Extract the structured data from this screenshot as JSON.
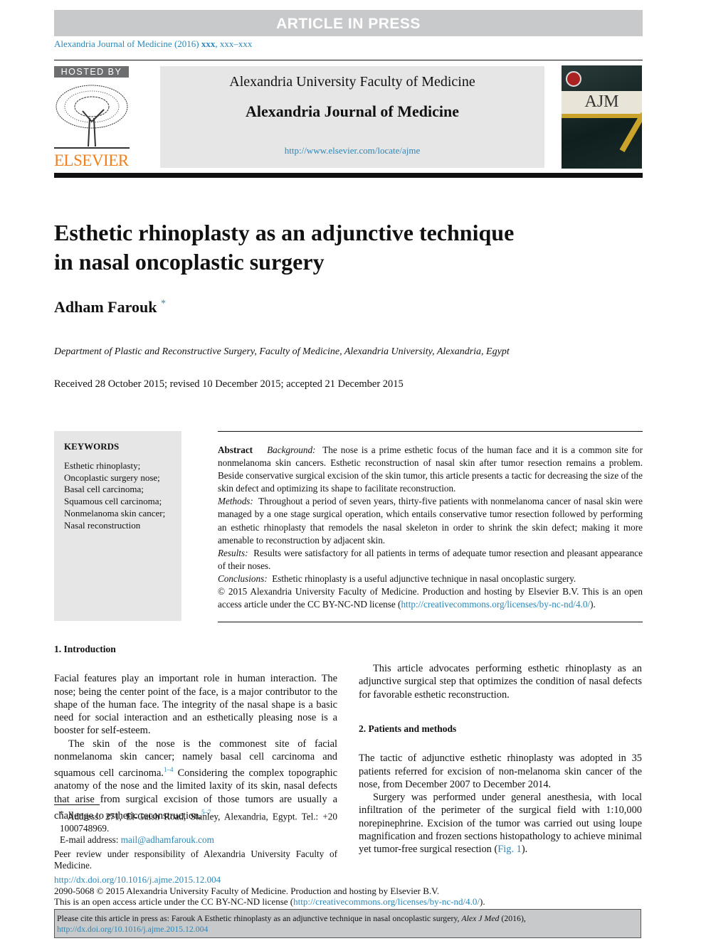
{
  "banner": "ARTICLE IN PRESS",
  "journal_ref": {
    "prefix": "Alexandria Journal of Medicine (2016) ",
    "bold": "xxx",
    ",suffix": ", xxx–xxx"
  },
  "header": {
    "hosted_by": "HOSTED BY",
    "publisher_logo": "ELSEVIER",
    "university": "Alexandria University Faculty of Medicine",
    "journal": "Alexandria Journal of Medicine",
    "url": "http://www.elsevier.com/locate/ajme",
    "cover_logo": "AJM"
  },
  "article": {
    "title_line1": "Esthetic rhinoplasty as an adjunctive technique",
    "title_line2": "in nasal oncoplastic surgery",
    "author": "Adham Farouk",
    "author_mark": "*",
    "affiliation": "Department of Plastic and Reconstructive Surgery, Faculty of Medicine, Alexandria University, Alexandria, Egypt",
    "dates": "Received 28 October 2015; revised 10 December 2015; accepted 21 December 2015"
  },
  "keywords": {
    "heading": "KEYWORDS",
    "items": [
      "Esthetic rhinoplasty;",
      "Oncoplastic surgery nose;",
      "Basal cell carcinoma;",
      "Squamous cell carcinoma;",
      "Nonmelanoma skin cancer;",
      "Nasal reconstruction"
    ]
  },
  "abstract": {
    "label": "Abstract",
    "background_label": "Background:",
    "background": "The nose is a prime esthetic focus of the human face and it is a common site for nonmelanoma skin cancers. Esthetic reconstruction of nasal skin after tumor resection remains a problem. Beside conservative surgical excision of the skin tumor, this article presents a tactic for decreasing the size of the skin defect and optimizing its shape to facilitate reconstruction.",
    "methods_label": "Methods:",
    "methods": "Throughout a period of seven years, thirty-five patients with nonmelanoma cancer of nasal skin were managed by a one stage surgical operation, which entails conservative tumor resection followed by performing an esthetic rhinoplasty that remodels the nasal skeleton in order to shrink the skin defect; making it more amenable to reconstruction by adjacent skin.",
    "results_label": "Results:",
    "results": "Results were satisfactory for all patients in terms of adequate tumor resection and pleasant appearance of their noses.",
    "conclusions_label": "Conclusions:",
    "conclusions": "Esthetic rhinoplasty is a useful adjunctive technique in nasal oncoplastic surgery.",
    "copyright": "© 2015 Alexandria University Faculty of Medicine. Production and hosting by Elsevier B.V. This is an open access article under the CC BY-NC-ND license (",
    "license_url": "http://creativecommons.org/licenses/by-nc-nd/4.0/",
    "copyright_end": ")."
  },
  "intro": {
    "heading": "1. Introduction",
    "p1": "Facial features play an important role in human interaction. The nose; being the center point of the face, is a major contributor to the shape of the human face. The integrity of the nasal shape is a basic need for social interaction and an esthetically pleasing nose is a booster for self-esteem.",
    "p2": "The skin of the nose is the commonest site of facial nonmelanoma skin cancer; namely basal cell carcinoma and squamous cell carcinoma.",
    "p2_ref": "1–4",
    "p2b": " Considering the complex topographic anatomy of the nose and the limited laxity of its skin, nasal defects that arise from surgical excision of those tumors are usually a challenge to esthetic reconstruction.",
    "p2b_ref": "5–7",
    "p3": "This article advocates performing esthetic rhinoplasty as an adjunctive surgical step that optimizes the condition of nasal defects for favorable esthetic reconstruction."
  },
  "methods": {
    "heading": "2. Patients and methods",
    "p1": "The tactic of adjunctive esthetic rhinoplasty was adopted in 35 patients referred for excision of non-melanoma skin cancer of the nose, from December 2007 to December 2014.",
    "p2": "Surgery was performed under general anesthesia, with local infiltration of the perimeter of the surgical field with 1:10,000 norepinephrine. Excision of the tumor was carried out using loupe magnification and frozen sections histopathology to achieve minimal yet tumor-free surgical resection (",
    "fig_ref": "Fig. 1",
    "p2_end": ")."
  },
  "footnote": {
    "mark": "*",
    "address": "Address: 271, El-Gaish Road, Stanley, Alexandria, Egypt. Tel.: +20 1000748969.",
    "email_label": "E-mail address: ",
    "email": "mail@adhamfarouk.com",
    "peer_review": "Peer review under responsibility of Alexandria University Faculty of Medicine."
  },
  "bottom": {
    "doi": "http://dx.doi.org/10.1016/j.ajme.2015.12.004",
    "issn": "2090-5068 © 2015 Alexandria University Faculty of Medicine. Production and hosting by Elsevier B.V.",
    "license_prefix": "This is an open access article under the CC BY-NC-ND license (",
    "license_url": "http://creativecommons.org/licenses/by-nc-nd/4.0/",
    "license_suffix": ")."
  },
  "cite_box": {
    "text": "Please cite this article in press as: Farouk A Esthetic rhinoplasty as an adjunctive technique  in nasal oncoplastic surgery, ",
    "journal": "Alex J Med",
    "year": " (2016), ",
    "doi": "http://dx.doi.org/10.1016/j.ajme.2015.12.004"
  }
}
